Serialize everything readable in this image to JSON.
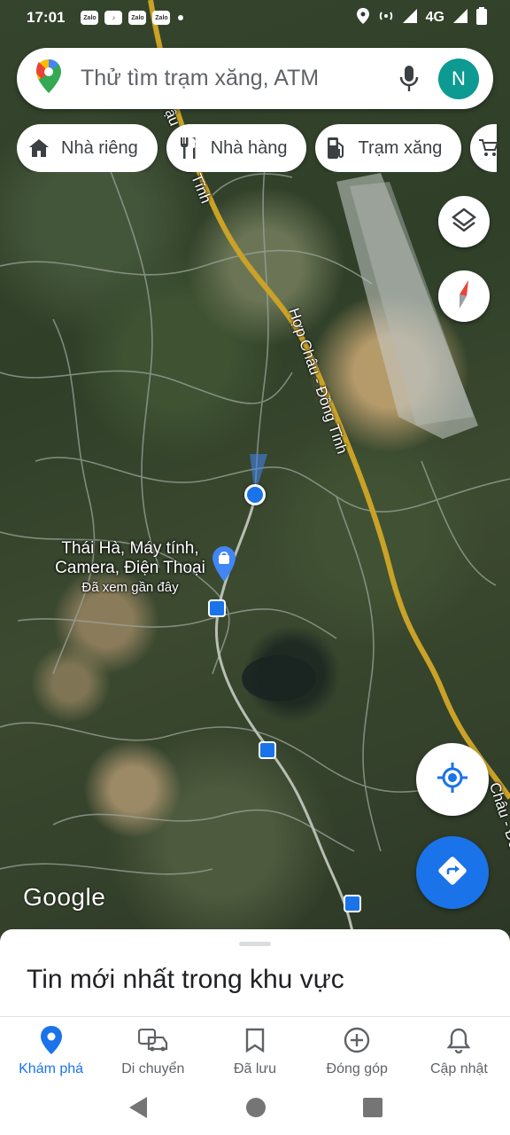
{
  "status_bar": {
    "time": "17:01",
    "notifications": [
      "Zalo",
      "TikTok",
      "Zalo",
      "Zalo"
    ],
    "network": "4G"
  },
  "search": {
    "placeholder": "Thử tìm trạm xăng, ATM",
    "avatar_letter": "N"
  },
  "chips": [
    {
      "label": "Nhà riêng",
      "icon": "home-icon"
    },
    {
      "label": "Nhà hàng",
      "icon": "restaurant-icon"
    },
    {
      "label": "Trạm xăng",
      "icon": "gas-station-icon"
    }
  ],
  "map": {
    "road_name": "Hợp Châu - Đồng Tĩnh",
    "road_name_partial_top": "ậu - Đồng Tĩnh",
    "road_name_partial_bottom": "Châu - Đồ",
    "place": {
      "name_line1": "Thái Hà, Máy tính,",
      "name_line2": "Camera, Điện Thoại",
      "subtitle": "Đã xem gần đây"
    },
    "logo": "Google"
  },
  "sheet": {
    "title": "Tin mới nhất trong khu vực"
  },
  "bottom_nav": [
    {
      "label": "Khám phá",
      "icon": "explore-pin-icon",
      "active": true
    },
    {
      "label": "Di chuyển",
      "icon": "commute-car-icon",
      "active": false
    },
    {
      "label": "Đã lưu",
      "icon": "bookmark-icon",
      "active": false
    },
    {
      "label": "Đóng góp",
      "icon": "add-circle-icon",
      "active": false
    },
    {
      "label": "Cập nhật",
      "icon": "bell-icon",
      "active": false
    }
  ],
  "colors": {
    "accent": "#1a73e8",
    "avatar": "#0c9a93",
    "road": "#c9a227",
    "location_dot": "#1a73e8"
  }
}
